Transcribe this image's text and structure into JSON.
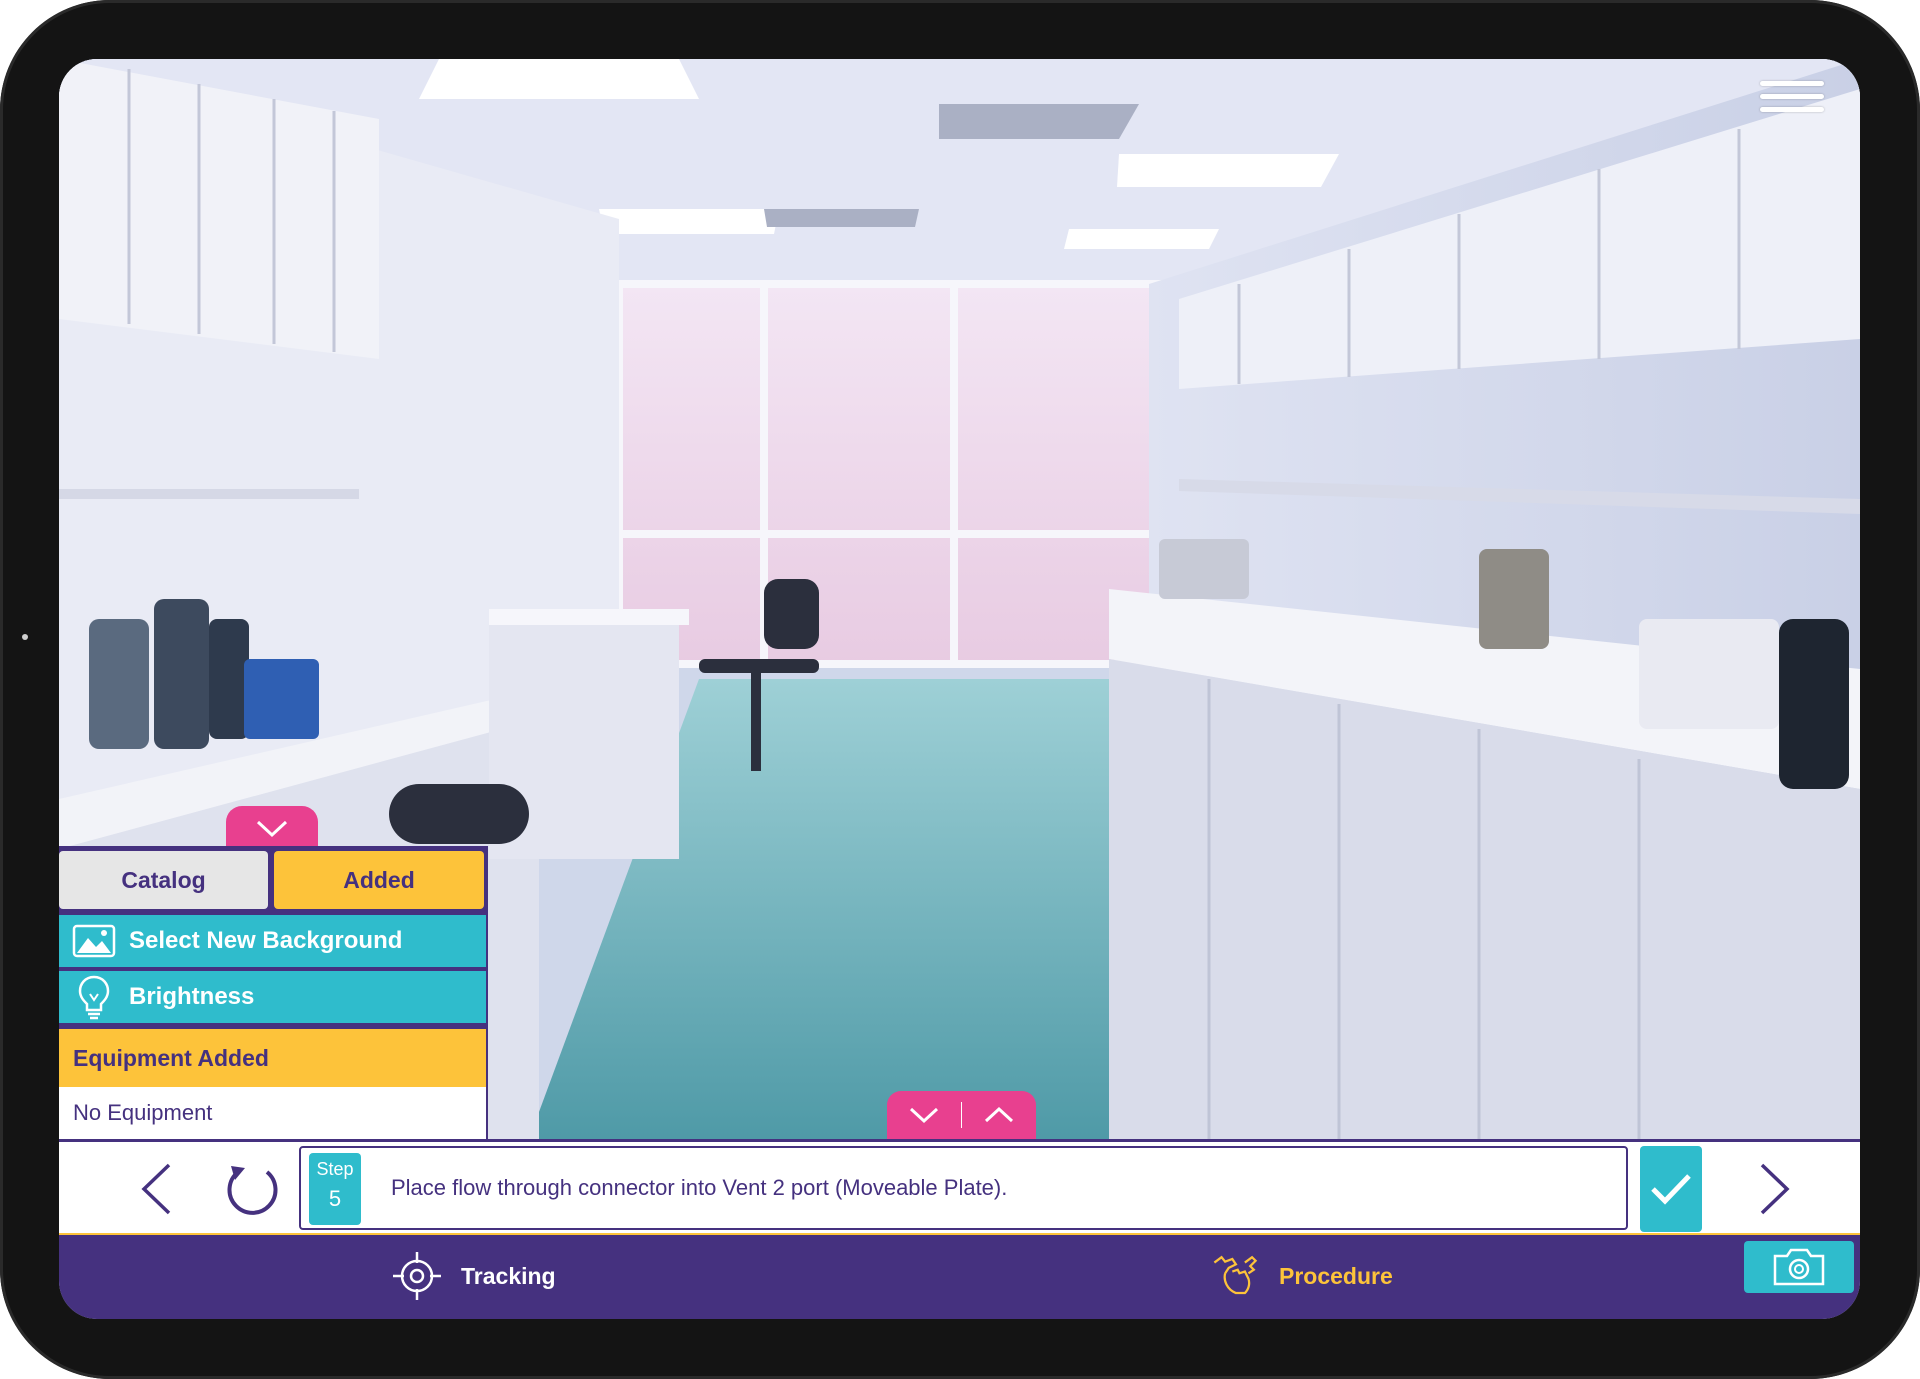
{
  "panel": {
    "tabs": [
      {
        "label": "Catalog"
      },
      {
        "label": "Added"
      }
    ],
    "select_background_label": "Select New Background",
    "brightness_label": "Brightness",
    "equipment_header": "Equipment Added",
    "equipment_empty": "No Equipment"
  },
  "step": {
    "label": "Step",
    "number": "5",
    "text": "Place flow through connector into Vent 2 port (Moveable Plate)."
  },
  "bottom_nav": {
    "tracking_label": "Tracking",
    "procedure_label": "Procedure"
  },
  "icons": {
    "menu": "hamburger-icon",
    "collapse": "chevron-down-icon",
    "background": "image-icon",
    "brightness": "lightbulb-icon",
    "prev": "chevron-left-icon",
    "reset": "refresh-icon",
    "confirm": "check-icon",
    "next": "chevron-right-icon",
    "tracking": "crosshair-icon",
    "procedure": "hand-wrench-icon",
    "camera": "camera-icon"
  },
  "colors": {
    "purple": "#45317f",
    "teal": "#2fbccc",
    "yellow": "#fdc33a",
    "pink": "#e8408f",
    "light_gray": "#e6e6e6"
  }
}
